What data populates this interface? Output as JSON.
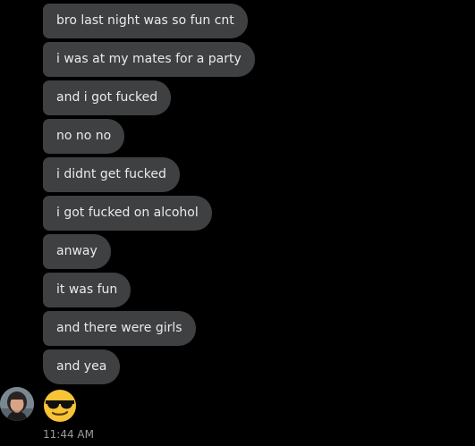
{
  "messages": [
    "bro last night was so fun cnt",
    "i was at my mates for a party",
    "and i got fucked",
    "no no no",
    "i didnt get fucked",
    "i got fucked on alcohol",
    "anway",
    "it was fun",
    "and there were girls",
    "and yea"
  ],
  "emoji_reaction": "sunglasses-face",
  "timestamp": "11:44 AM",
  "colors": {
    "background": "#000000",
    "bubble": "#3e4042",
    "text": "#e8eaed",
    "timestamp": "#9a9da1",
    "emoji": "#f7c436"
  }
}
